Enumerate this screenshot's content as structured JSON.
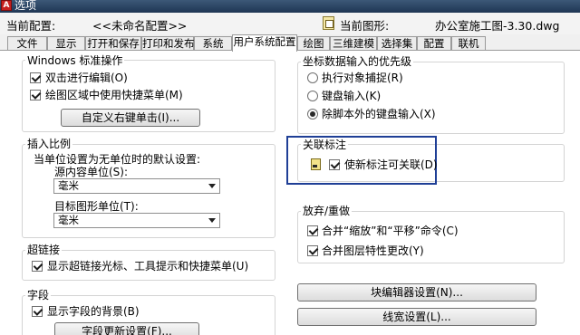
{
  "window": {
    "title": "选项"
  },
  "info": {
    "current_profile_label": "当前配置:",
    "current_profile_value": "<<未命名配置>>",
    "current_drawing_label": "当前图形:",
    "current_drawing_value": "办公室施工图-3.30.dwg"
  },
  "tabs": [
    {
      "label": "文件"
    },
    {
      "label": "显示"
    },
    {
      "label": "打开和保存"
    },
    {
      "label": "打印和发布"
    },
    {
      "label": "系统"
    },
    {
      "label": "用户系统配置"
    },
    {
      "label": "绘图"
    },
    {
      "label": "三维建模"
    },
    {
      "label": "选择集"
    },
    {
      "label": "配置"
    },
    {
      "label": "联机"
    }
  ],
  "active_tab": "用户系统配置",
  "windows_standard": {
    "title": "Windows 标准操作",
    "double_click_edit": "双击进行编辑(O)",
    "shortcut_menu": "绘图区域中使用快捷菜单(M)",
    "right_click_button": "自定义右键单击(I)..."
  },
  "insert_scale": {
    "title": "插入比例",
    "description": "当单位设置为无单位时的默认设置:",
    "source_label": "源内容单位(S):",
    "source_value": "毫米",
    "target_label": "目标图形单位(T):",
    "target_value": "毫米"
  },
  "hyperlink": {
    "title": "超链接",
    "option": "显示超链接光标、工具提示和快捷菜单(U)"
  },
  "field": {
    "title": "字段",
    "option": "显示字段的背景(B)",
    "update_button": "字段更新设置(F)..."
  },
  "coord_priority": {
    "title": "坐标数据输入的优先级",
    "option1": "执行对象捕捉(R)",
    "option2": "键盘输入(K)",
    "option3": "除脚本外的键盘输入(X)"
  },
  "associative_dim": {
    "title": "关联标注",
    "option": "使新标注可关联(D)"
  },
  "undo_redo": {
    "title": "放弃/重做",
    "option1": "合并“缩放”和“平移”命令(C)",
    "option2": "合并图层特性更改(Y)"
  },
  "buttons": {
    "block_editor": "块编辑器设置(N)...",
    "lineweight": "线宽设置(L)..."
  }
}
